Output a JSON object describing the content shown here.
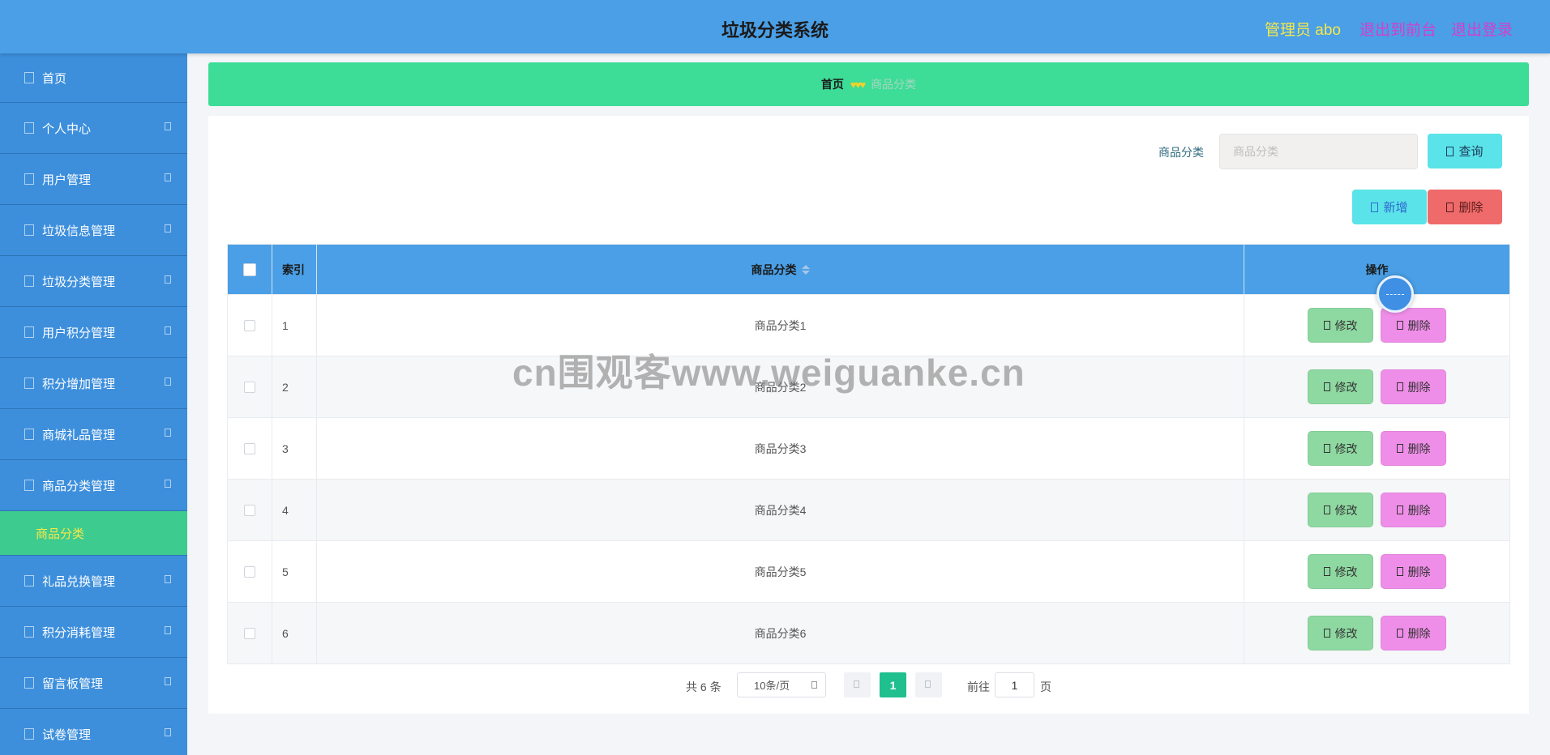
{
  "header": {
    "title": "垃圾分类系统",
    "user": "管理员 abo",
    "back_to_front": "退出到前台",
    "logout": "退出登录"
  },
  "sidebar": {
    "items": [
      {
        "label": "首页"
      },
      {
        "label": "个人中心"
      },
      {
        "label": "用户管理"
      },
      {
        "label": "垃圾信息管理"
      },
      {
        "label": "垃圾分类管理"
      },
      {
        "label": "用户积分管理"
      },
      {
        "label": "积分增加管理"
      },
      {
        "label": "商城礼品管理"
      },
      {
        "label": "商品分类管理"
      },
      {
        "label": "礼品兑换管理"
      },
      {
        "label": "积分消耗管理"
      },
      {
        "label": "留言板管理"
      },
      {
        "label": "试卷管理"
      }
    ],
    "active_sub": "商品分类"
  },
  "breadcrumb": {
    "home": "首页",
    "separator": "♥♥♥",
    "current": "商品分类"
  },
  "search": {
    "label": "商品分类",
    "placeholder": "商品分类",
    "query_button": "查询"
  },
  "actions": {
    "add": "新增",
    "delete": "删除"
  },
  "table": {
    "headers": {
      "index": "索引",
      "name": "商品分类",
      "ops": "操作"
    },
    "rows": [
      {
        "index": "1",
        "name": "商品分类1"
      },
      {
        "index": "2",
        "name": "商品分类2"
      },
      {
        "index": "3",
        "name": "商品分类3"
      },
      {
        "index": "4",
        "name": "商品分类4"
      },
      {
        "index": "5",
        "name": "商品分类5"
      },
      {
        "index": "6",
        "name": "商品分类6"
      }
    ],
    "edit_label": "修改",
    "delete_label": "删除"
  },
  "pagination": {
    "total": "共 6 条",
    "page_size": "10条/页",
    "current_page": "1",
    "goto_label": "前往",
    "goto_value": "1",
    "page_unit": "页"
  },
  "watermark": "cn围观客www.weiguanke.cn",
  "colors": {
    "header_bg": "#4a9fe6",
    "sidebar_bg": "#3d8fdc",
    "active_sub_bg": "#3dcb8f",
    "breadcrumb_bg": "#3ddc97",
    "edit_button": "#8ed9a1",
    "delete_row_button": "#ef8ee8",
    "delete_button": "#ef6a6a",
    "add_query_button": "#5ae3e8",
    "pager_active": "#1fbf8e"
  }
}
